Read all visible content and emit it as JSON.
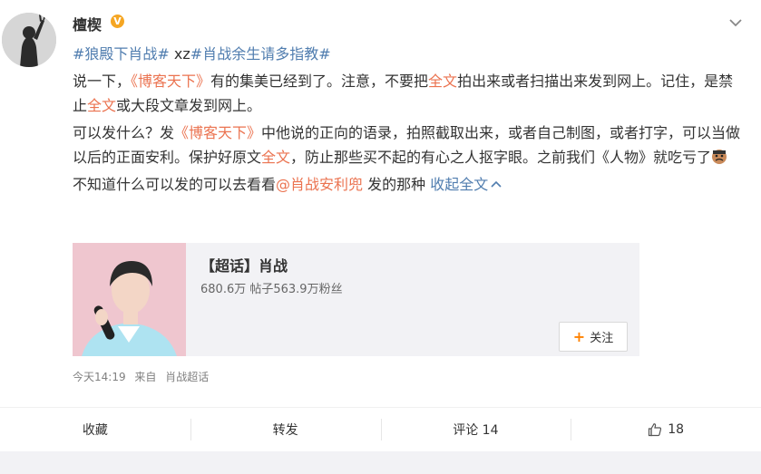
{
  "post": {
    "username": "檀楔",
    "verified_badge": "V",
    "topics_line": {
      "t1": "#狼殿下肖战#",
      "sep": " xz",
      "t2": "#肖战余生请多指教#"
    },
    "p1": {
      "a": "说一下，",
      "b": "《博客天下》",
      "c": "有的集美已经到了。注意，不要把",
      "d": "全文",
      "e": "拍出来或者扫描出来发到网上。记住，是禁止",
      "f": "全文",
      "g": "或大段文章发到网上。"
    },
    "p2": {
      "a": "可以发什么？发",
      "b": "《博客天下》",
      "c": "中他说的正向的语录，拍照截取出来，或者自己制图，或者打字，可以当做以后的正面安利。保护好原文",
      "d": "全文",
      "e": "，防止那些买不起的有心之人抠字眼。之前我们《人物》就吃亏了"
    },
    "p3": {
      "a": "不知道什么可以发的可以去看看",
      "mention": "@肖战安利兜",
      "b": " 发的那种 ",
      "collapse": "收起全文"
    },
    "emoji_name": "angry-emoji"
  },
  "super_topic": {
    "title": "【超话】肖战",
    "stats": "680.6万  帖子563.9万粉丝",
    "follow_label": "关注"
  },
  "meta": {
    "time": "今天14:19",
    "source_prefix": "来自",
    "source": "肖战超话"
  },
  "actions": {
    "collect": "收藏",
    "repost": "转发",
    "comment": "评论 14",
    "like_count": "18"
  },
  "colors": {
    "accent": "#eb7350",
    "link_blue": "#507daf",
    "badge": "#f5a623",
    "follow_plus": "#ff8200"
  }
}
